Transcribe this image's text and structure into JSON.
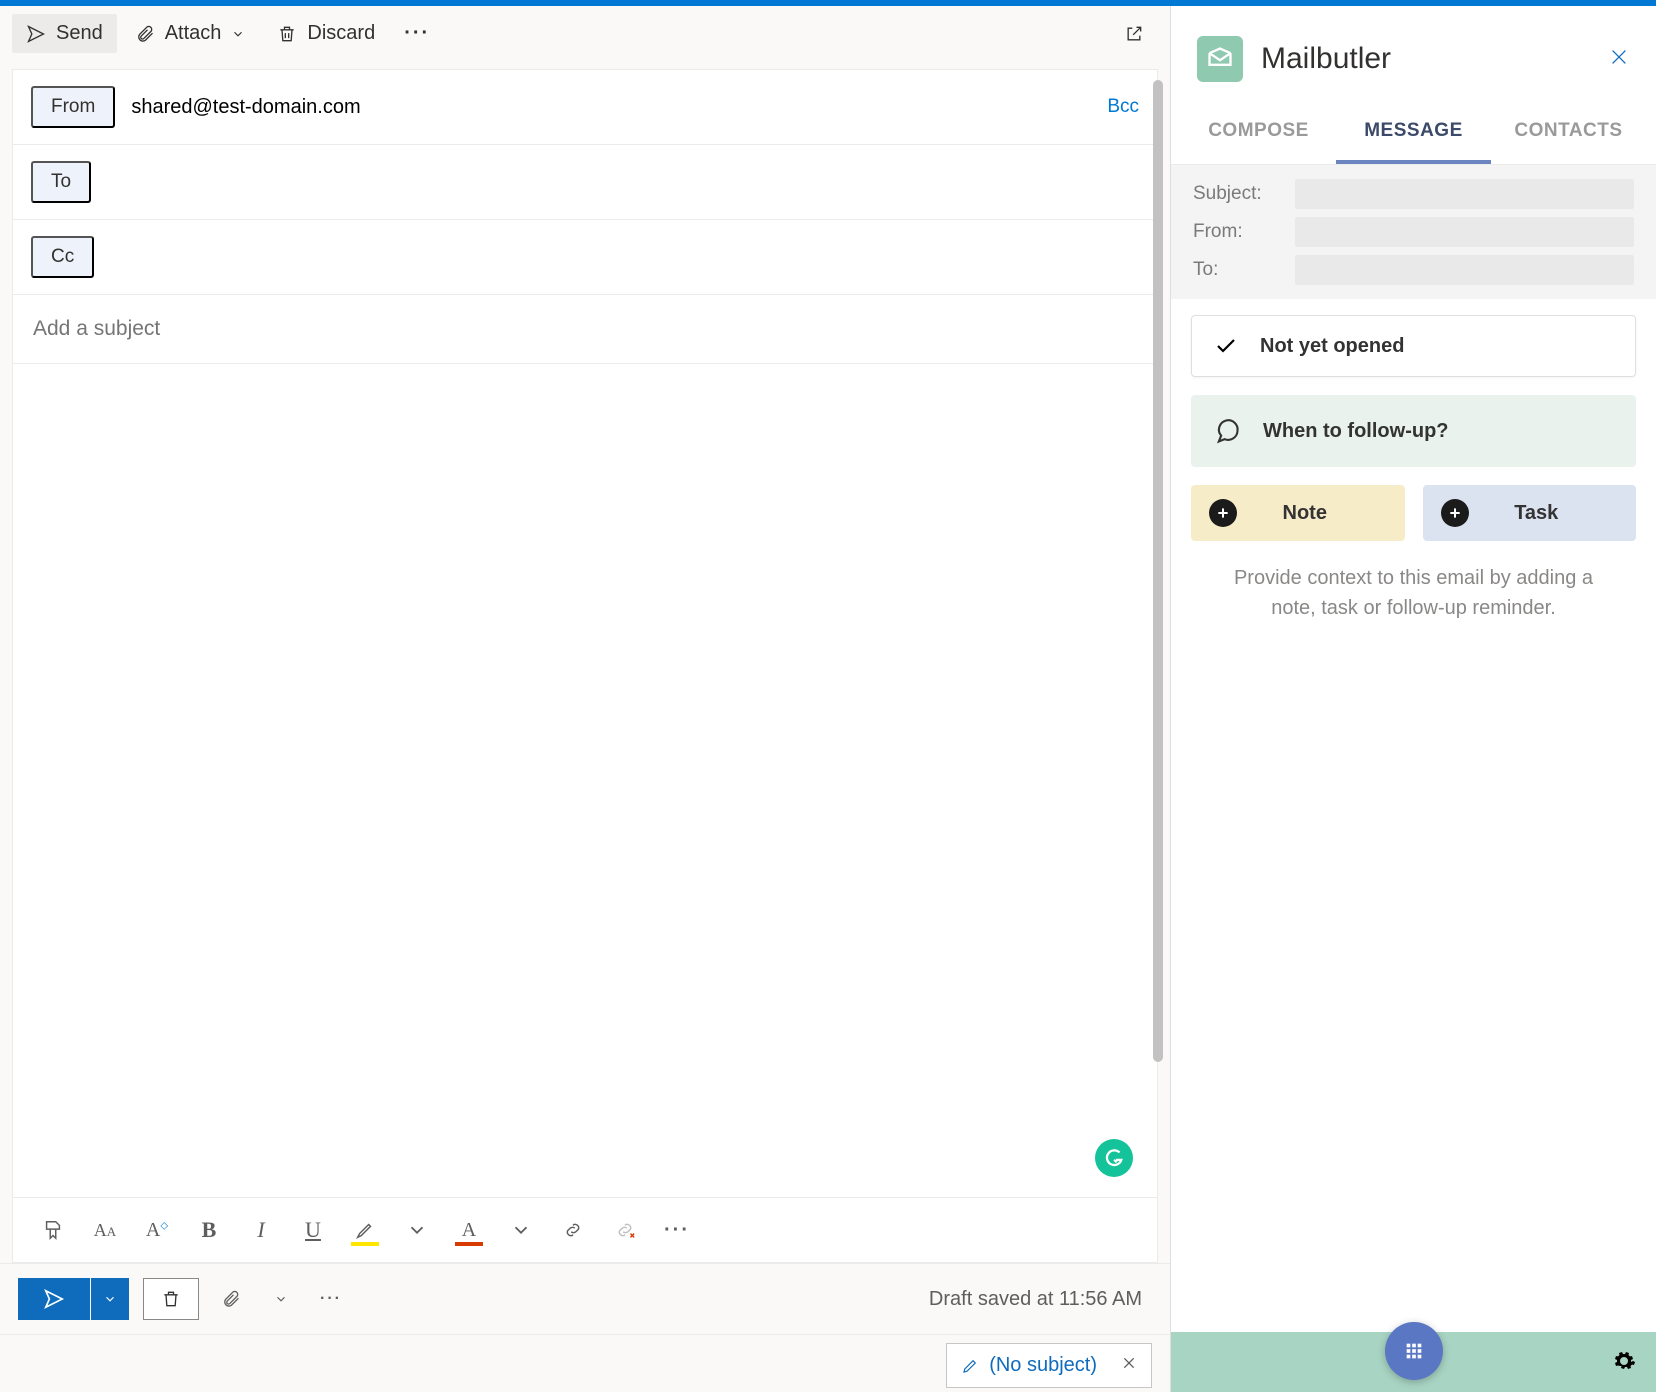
{
  "toolbar": {
    "send_label": "Send",
    "attach_label": "Attach",
    "discard_label": "Discard"
  },
  "compose": {
    "from_label": "From",
    "from_value": "shared@test-domain.com",
    "bcc_label": "Bcc",
    "to_label": "To",
    "to_value": "",
    "cc_label": "Cc",
    "cc_value": "",
    "subject_placeholder": "Add a subject",
    "subject_value": "",
    "body_value": ""
  },
  "status": {
    "draft_saved": "Draft saved at 11:56 AM"
  },
  "draft_chip": {
    "label": "(No subject)"
  },
  "panel": {
    "title": "Mailbutler",
    "tabs": {
      "compose": "COMPOSE",
      "message": "MESSAGE",
      "contacts": "CONTACTS"
    },
    "meta": {
      "subject_label": "Subject:",
      "from_label": "From:",
      "to_label": "To:"
    },
    "tracking_status": "Not yet opened",
    "followup_prompt": "When to follow-up?",
    "note_label": "Note",
    "task_label": "Task",
    "hint": "Provide context to this email by adding a note, task or follow-up reminder."
  }
}
